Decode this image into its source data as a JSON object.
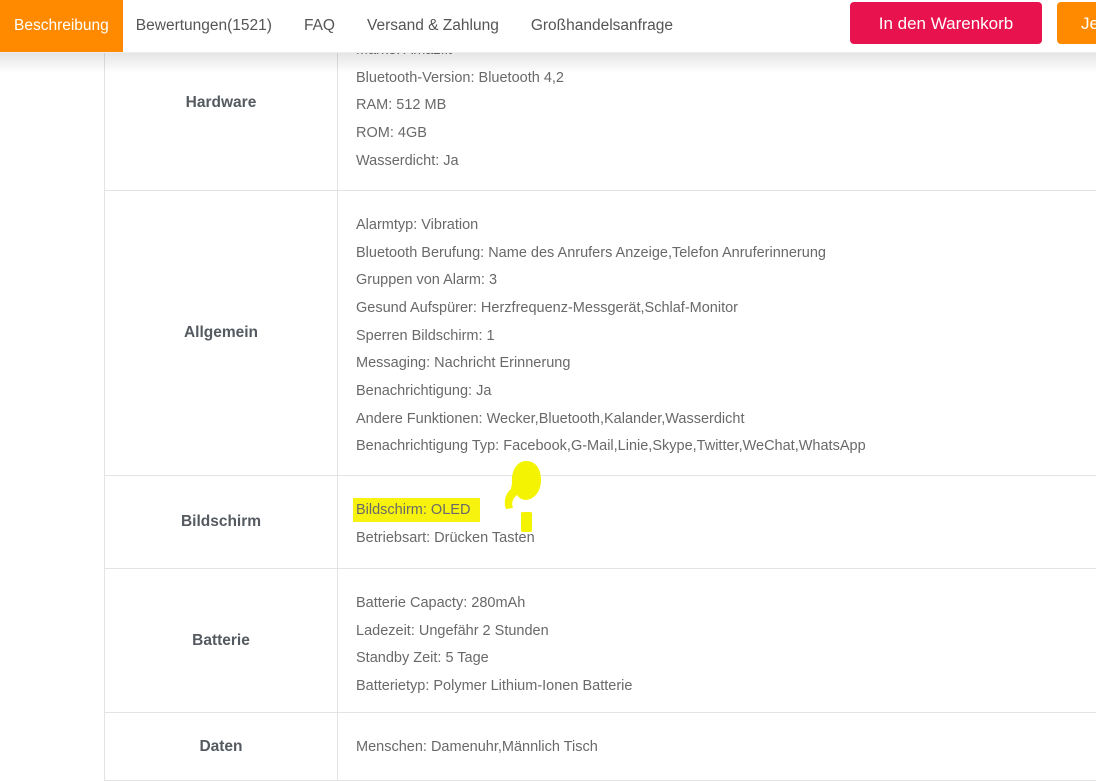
{
  "nav": {
    "tabs": [
      {
        "label": "Beschreibung",
        "active": true
      },
      {
        "label": "Bewertungen(1521)",
        "active": false
      },
      {
        "label": "FAQ",
        "active": false
      },
      {
        "label": "Versand & Zahlung",
        "active": false
      },
      {
        "label": "Großhandelsanfrage",
        "active": false
      }
    ],
    "add_to_cart_label": "In den Warenkorb",
    "buy_now_label": "Jetzt kaufen"
  },
  "spec_table": {
    "rows": [
      {
        "label": "Hardware",
        "items": [
          "Marke: Amazfit",
          "Bluetooth-Version: Bluetooth 4,2",
          "RAM: 512 MB",
          "ROM: 4GB",
          "Wasserdicht: Ja"
        ]
      },
      {
        "label": "Allgemein",
        "items": [
          "Alarmtyp: Vibration",
          "Bluetooth Berufung: Name des Anrufers Anzeige,Telefon Anruferinnerung",
          "Gruppen von Alarm: 3",
          "Gesund Aufspürer: Herzfrequenz-Messgerät,Schlaf-Monitor",
          "Sperren Bildschirm: 1",
          "Messaging: Nachricht Erinnerung",
          "Benachrichtigung: Ja",
          "Andere Funktionen: Wecker,Bluetooth,Kalander,Wasserdicht",
          "Benachrichtigung Typ: Facebook,G-Mail,Linie,Skype,Twitter,WeChat,WhatsApp"
        ]
      },
      {
        "label": "Bildschirm",
        "items": [
          "Bildschirm: OLED",
          "Betriebsart: Drücken Tasten"
        ],
        "highlighted_item": "Bildschirm: OLED"
      },
      {
        "label": "Batterie",
        "items": [
          "Batterie Capacty: 280mAh",
          "Ladezeit: Ungefähr 2 Stunden",
          "Standby Zeit: 5 Tage",
          "Batterietyp: Polymer Lithium-Ionen Batterie"
        ]
      },
      {
        "label": "Daten",
        "items": [
          "Menschen: Damenuhr,Männlich Tisch"
        ]
      }
    ]
  },
  "colors": {
    "accent_orange": "#ff8a00",
    "accent_red": "#e8124e",
    "table_border": "#e3e3e3",
    "highlight_yellow": "#f7f30e",
    "marker_yellow": "#f3f302"
  }
}
